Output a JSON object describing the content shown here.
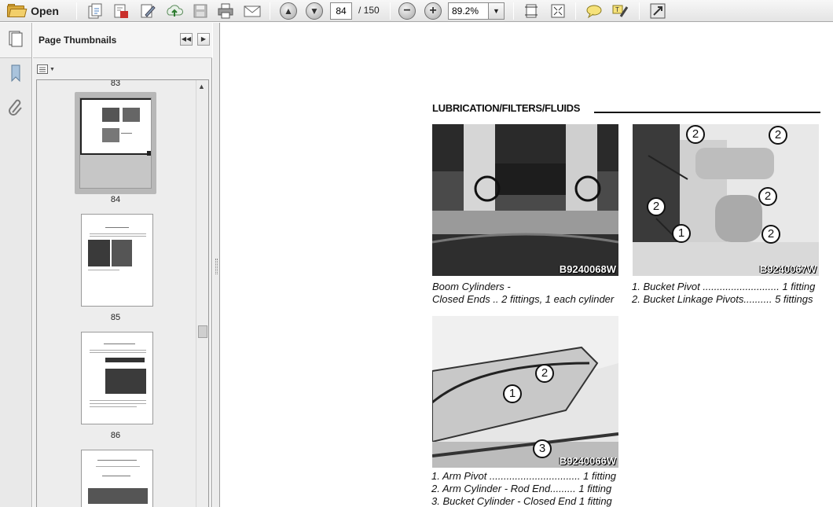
{
  "toolbar": {
    "open_label": "Open",
    "page_current": "84",
    "page_total": "/ 150",
    "zoom_value": "89.2%"
  },
  "sidebar": {
    "title": "Page Thumbnails",
    "thumbnails": [
      {
        "page": "83"
      },
      {
        "page": "84"
      },
      {
        "page": "85"
      },
      {
        "page": "86"
      }
    ]
  },
  "document": {
    "heading": "LUBRICATION/FILTERS/FLUIDS",
    "figures": [
      {
        "code": "B9240068W",
        "caption_lines": [
          "Boom Cylinders -",
          "Closed Ends .. 2 fittings, 1 each cylinder"
        ]
      },
      {
        "code": "B9240067W",
        "caption_lines": [
          "1. Bucket Pivot ........................... 1 fitting",
          "2. Bucket Linkage Pivots.......... 5 fittings"
        ]
      },
      {
        "code": "B9240066W",
        "caption_lines": [
          "1. Arm Pivot ................................ 1 fitting",
          "2. Arm Cylinder - Rod End......... 1 fitting",
          "3. Bucket Cylinder - Closed End 1 fitting"
        ]
      }
    ],
    "callouts": {
      "fig2": [
        "2",
        "2",
        "2",
        "2",
        "1",
        "2"
      ],
      "fig3": [
        "1",
        "2",
        "3"
      ]
    }
  }
}
